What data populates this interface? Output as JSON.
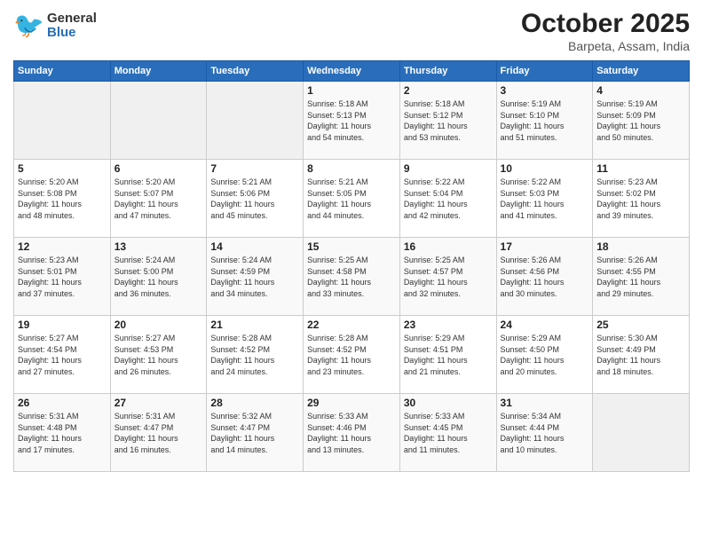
{
  "header": {
    "logo": {
      "general": "General",
      "blue": "Blue"
    },
    "title": "October 2025",
    "subtitle": "Barpeta, Assam, India"
  },
  "days_of_week": [
    "Sunday",
    "Monday",
    "Tuesday",
    "Wednesday",
    "Thursday",
    "Friday",
    "Saturday"
  ],
  "weeks": [
    [
      {
        "day": "",
        "info": ""
      },
      {
        "day": "",
        "info": ""
      },
      {
        "day": "",
        "info": ""
      },
      {
        "day": "1",
        "info": "Sunrise: 5:18 AM\nSunset: 5:13 PM\nDaylight: 11 hours\nand 54 minutes."
      },
      {
        "day": "2",
        "info": "Sunrise: 5:18 AM\nSunset: 5:12 PM\nDaylight: 11 hours\nand 53 minutes."
      },
      {
        "day": "3",
        "info": "Sunrise: 5:19 AM\nSunset: 5:10 PM\nDaylight: 11 hours\nand 51 minutes."
      },
      {
        "day": "4",
        "info": "Sunrise: 5:19 AM\nSunset: 5:09 PM\nDaylight: 11 hours\nand 50 minutes."
      }
    ],
    [
      {
        "day": "5",
        "info": "Sunrise: 5:20 AM\nSunset: 5:08 PM\nDaylight: 11 hours\nand 48 minutes."
      },
      {
        "day": "6",
        "info": "Sunrise: 5:20 AM\nSunset: 5:07 PM\nDaylight: 11 hours\nand 47 minutes."
      },
      {
        "day": "7",
        "info": "Sunrise: 5:21 AM\nSunset: 5:06 PM\nDaylight: 11 hours\nand 45 minutes."
      },
      {
        "day": "8",
        "info": "Sunrise: 5:21 AM\nSunset: 5:05 PM\nDaylight: 11 hours\nand 44 minutes."
      },
      {
        "day": "9",
        "info": "Sunrise: 5:22 AM\nSunset: 5:04 PM\nDaylight: 11 hours\nand 42 minutes."
      },
      {
        "day": "10",
        "info": "Sunrise: 5:22 AM\nSunset: 5:03 PM\nDaylight: 11 hours\nand 41 minutes."
      },
      {
        "day": "11",
        "info": "Sunrise: 5:23 AM\nSunset: 5:02 PM\nDaylight: 11 hours\nand 39 minutes."
      }
    ],
    [
      {
        "day": "12",
        "info": "Sunrise: 5:23 AM\nSunset: 5:01 PM\nDaylight: 11 hours\nand 37 minutes."
      },
      {
        "day": "13",
        "info": "Sunrise: 5:24 AM\nSunset: 5:00 PM\nDaylight: 11 hours\nand 36 minutes."
      },
      {
        "day": "14",
        "info": "Sunrise: 5:24 AM\nSunset: 4:59 PM\nDaylight: 11 hours\nand 34 minutes."
      },
      {
        "day": "15",
        "info": "Sunrise: 5:25 AM\nSunset: 4:58 PM\nDaylight: 11 hours\nand 33 minutes."
      },
      {
        "day": "16",
        "info": "Sunrise: 5:25 AM\nSunset: 4:57 PM\nDaylight: 11 hours\nand 32 minutes."
      },
      {
        "day": "17",
        "info": "Sunrise: 5:26 AM\nSunset: 4:56 PM\nDaylight: 11 hours\nand 30 minutes."
      },
      {
        "day": "18",
        "info": "Sunrise: 5:26 AM\nSunset: 4:55 PM\nDaylight: 11 hours\nand 29 minutes."
      }
    ],
    [
      {
        "day": "19",
        "info": "Sunrise: 5:27 AM\nSunset: 4:54 PM\nDaylight: 11 hours\nand 27 minutes."
      },
      {
        "day": "20",
        "info": "Sunrise: 5:27 AM\nSunset: 4:53 PM\nDaylight: 11 hours\nand 26 minutes."
      },
      {
        "day": "21",
        "info": "Sunrise: 5:28 AM\nSunset: 4:52 PM\nDaylight: 11 hours\nand 24 minutes."
      },
      {
        "day": "22",
        "info": "Sunrise: 5:28 AM\nSunset: 4:52 PM\nDaylight: 11 hours\nand 23 minutes."
      },
      {
        "day": "23",
        "info": "Sunrise: 5:29 AM\nSunset: 4:51 PM\nDaylight: 11 hours\nand 21 minutes."
      },
      {
        "day": "24",
        "info": "Sunrise: 5:29 AM\nSunset: 4:50 PM\nDaylight: 11 hours\nand 20 minutes."
      },
      {
        "day": "25",
        "info": "Sunrise: 5:30 AM\nSunset: 4:49 PM\nDaylight: 11 hours\nand 18 minutes."
      }
    ],
    [
      {
        "day": "26",
        "info": "Sunrise: 5:31 AM\nSunset: 4:48 PM\nDaylight: 11 hours\nand 17 minutes."
      },
      {
        "day": "27",
        "info": "Sunrise: 5:31 AM\nSunset: 4:47 PM\nDaylight: 11 hours\nand 16 minutes."
      },
      {
        "day": "28",
        "info": "Sunrise: 5:32 AM\nSunset: 4:47 PM\nDaylight: 11 hours\nand 14 minutes."
      },
      {
        "day": "29",
        "info": "Sunrise: 5:33 AM\nSunset: 4:46 PM\nDaylight: 11 hours\nand 13 minutes."
      },
      {
        "day": "30",
        "info": "Sunrise: 5:33 AM\nSunset: 4:45 PM\nDaylight: 11 hours\nand 11 minutes."
      },
      {
        "day": "31",
        "info": "Sunrise: 5:34 AM\nSunset: 4:44 PM\nDaylight: 11 hours\nand 10 minutes."
      },
      {
        "day": "",
        "info": ""
      }
    ]
  ]
}
